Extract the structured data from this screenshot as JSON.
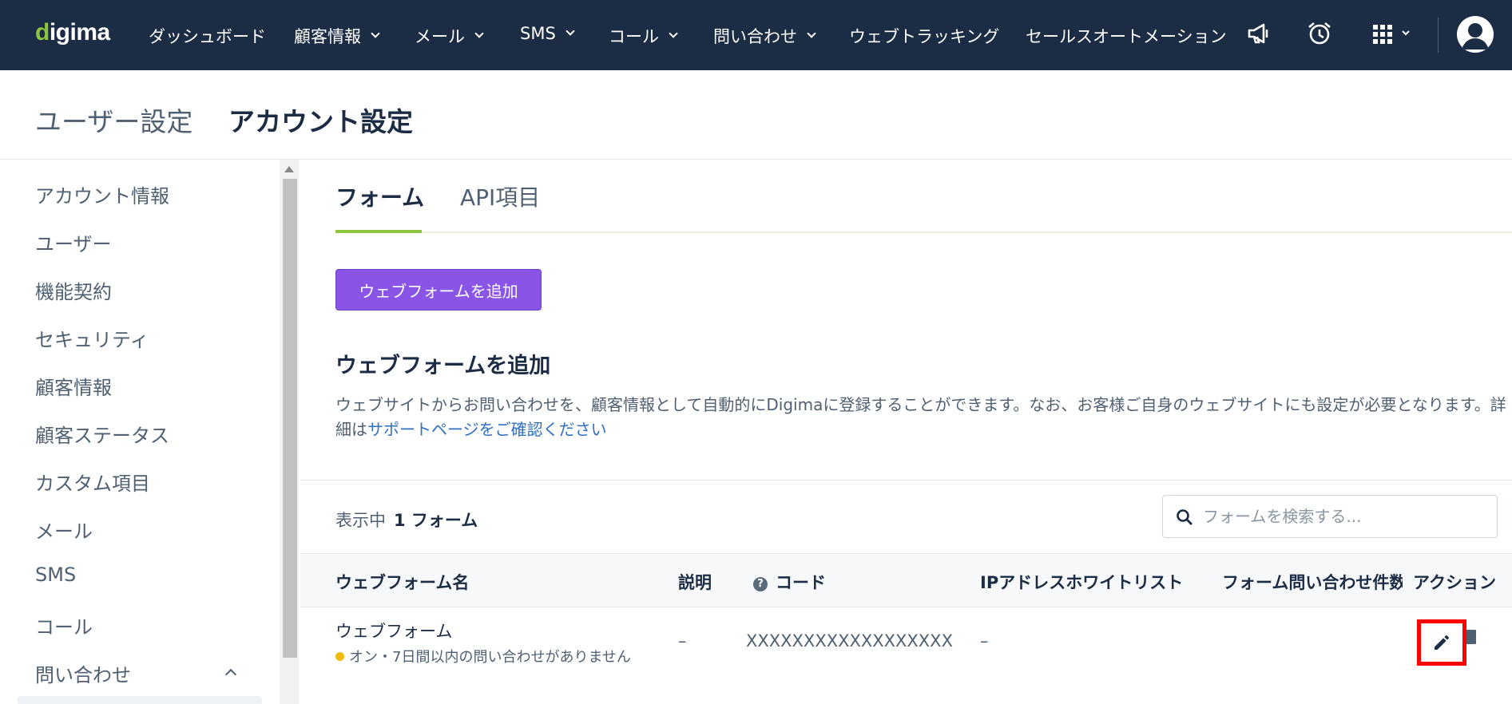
{
  "brand": {
    "logo": "digima"
  },
  "nav": {
    "items": [
      {
        "label": "ダッシュボード",
        "dropdown": false
      },
      {
        "label": "顧客情報",
        "dropdown": true
      },
      {
        "label": "メール",
        "dropdown": true
      },
      {
        "label": "SMS",
        "dropdown": true
      },
      {
        "label": "コール",
        "dropdown": true
      },
      {
        "label": "問い合わせ",
        "dropdown": true
      },
      {
        "label": "ウェブトラッキング",
        "dropdown": false
      },
      {
        "label": "セールスオートメーション",
        "dropdown": false
      }
    ],
    "icons": [
      "megaphone-icon",
      "alarm-clock-icon",
      "apps-grid-icon",
      "user-avatar-icon"
    ]
  },
  "breadcrumb": {
    "parent": "ユーザー設定",
    "current": "アカウント設定"
  },
  "sidebar": {
    "items": [
      {
        "label": "アカウント情報"
      },
      {
        "label": "ユーザー"
      },
      {
        "label": "機能契約"
      },
      {
        "label": "セキュリティ"
      },
      {
        "label": "顧客情報"
      },
      {
        "label": "顧客ステータス"
      },
      {
        "label": "カスタム項目"
      },
      {
        "label": "メール"
      },
      {
        "label": "SMS"
      },
      {
        "label": "コール"
      },
      {
        "label": "問い合わせ",
        "expanded": true
      }
    ]
  },
  "tabs": [
    {
      "label": "フォーム",
      "active": true
    },
    {
      "label": "API項目",
      "active": false
    }
  ],
  "main": {
    "add_button_label": "ウェブフォームを追加",
    "section_title": "ウェブフォームを追加",
    "description": "ウェブサイトからお問い合わせを、顧客情報として自動的にDigimaに登録することができます。なお、お客様ご自身のウェブサイトにも設定が必要となります。詳細は",
    "description_link": "サポートページをご確認ください"
  },
  "list": {
    "count_label": "表示中",
    "count_value": "1 フォーム",
    "search_placeholder": "フォームを検索する..."
  },
  "table": {
    "headers": [
      "ウェブフォーム名",
      "説明",
      "コード",
      "IPアドレスホワイトリスト",
      "フォーム問い合わせ件数",
      "アクション"
    ],
    "rows": [
      {
        "name": "ウェブフォーム",
        "status": "オン・7日間以内の問い合わせがありません",
        "description": "–",
        "code": "XXXXXXXXXXXXXXXXXX",
        "ip_whitelist": "–",
        "inquiry_count": ""
      }
    ]
  },
  "colors": {
    "nav_bg": "#1b2c44",
    "accent_green": "#8cc63f",
    "primary_button": "#8a55e6",
    "link": "#2f6fc0",
    "status_dot": "#f2b90f",
    "highlight": "#ff0000"
  }
}
